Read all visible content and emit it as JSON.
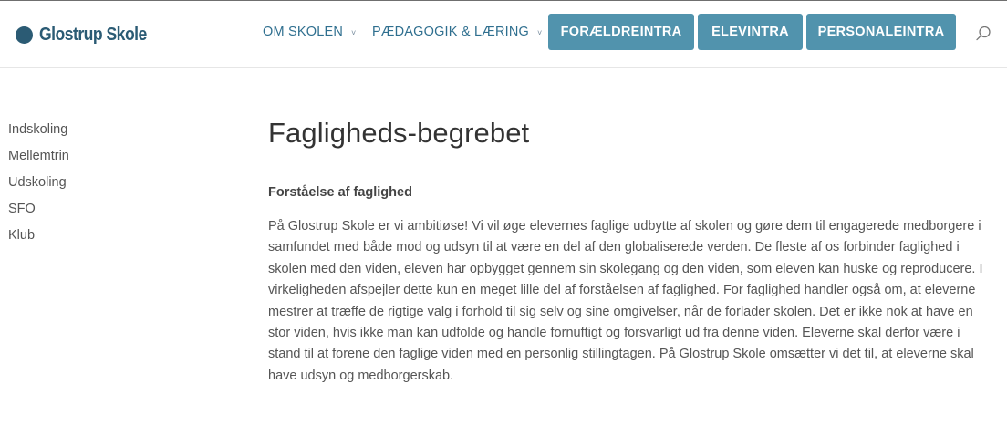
{
  "header": {
    "logo_text": "Glostrup Skole",
    "nav": [
      {
        "label": "OM SKOLEN",
        "chevron": "˅"
      },
      {
        "label": "PÆDAGOGIK & LÆRING",
        "chevron": "˅"
      }
    ],
    "buttons": [
      {
        "label": "FORÆLDREINTRA"
      },
      {
        "label": "ELEVINTRA"
      },
      {
        "label": "PERSONALEINTRA"
      }
    ],
    "search_icon": "search-icon"
  },
  "sidebar": {
    "items": [
      {
        "label": "Indskoling"
      },
      {
        "label": "Mellemtrin"
      },
      {
        "label": "Udskoling"
      },
      {
        "label": "SFO"
      },
      {
        "label": "Klub"
      }
    ]
  },
  "main": {
    "title": "Fagligheds-begrebet",
    "subheading": "Forståelse af faglighed",
    "paragraph": "På Glostrup Skole er vi ambitiøse! Vi vil øge elevernes faglige udbytte af skolen og gøre dem til engagerede medborgere i samfundet med både mod og udsyn til at være en del af den globaliserede verden. De fleste af os forbinder faglighed i skolen med den viden, eleven har opbygget gennem sin skolegang og den viden, som eleven kan huske og reproducere. I virkeligheden afspejler dette kun en meget lille del af forståelsen af faglighed. For faglighed handler også om, at eleverne mestrer at træffe de rigtige valg i forhold til sig selv og sine omgivelser, når de forlader skolen. Det er ikke nok at have en stor viden, hvis ikke man kan udfolde og handle fornuftigt og forsvarligt ud fra denne viden. Eleverne skal derfor være i stand til at forene den faglige viden med en personlig stillingtagen. På Glostrup Skole omsætter vi det til, at eleverne skal have udsyn og medborgerskab."
  },
  "colors": {
    "brand": "#2b5b74",
    "nav_text": "#2f6f8f",
    "button_bg": "#5193ad"
  }
}
